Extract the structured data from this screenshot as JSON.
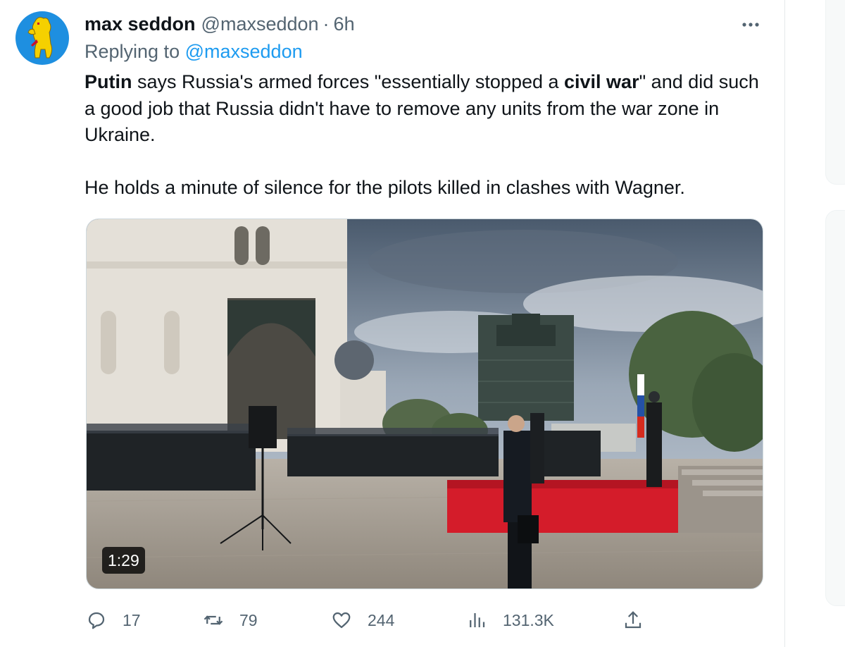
{
  "tweet": {
    "author_name": "max seddon",
    "author_handle": "@maxseddon",
    "separator": "·",
    "time": "6h",
    "replying_to_prefix": "Replying to",
    "replying_to_handle": "@maxseddon",
    "text_p1_bold1": "Putin",
    "text_p1_a": " says Russia's armed forces \"essentially stopped a ",
    "text_p1_bold2": "civil war",
    "text_p1_b": "\" and did such a good job that Russia didn't have to remove any units from the war zone in Ukraine.",
    "text_p2": "He holds a minute of silence for the pilots killed in clashes with Wagner."
  },
  "media": {
    "duration": "1:29",
    "icon": "video-player"
  },
  "actions": {
    "replies": "17",
    "reposts": "79",
    "likes": "244",
    "views": "131.3K"
  },
  "icons": {
    "more": "more-icon",
    "reply": "reply-icon",
    "repost": "repost-icon",
    "like": "like-icon",
    "views": "views-icon",
    "share": "share-icon"
  },
  "colors": {
    "link": "#1d9bf0",
    "secondary_text": "#536471",
    "primary_text": "#0f1419"
  }
}
